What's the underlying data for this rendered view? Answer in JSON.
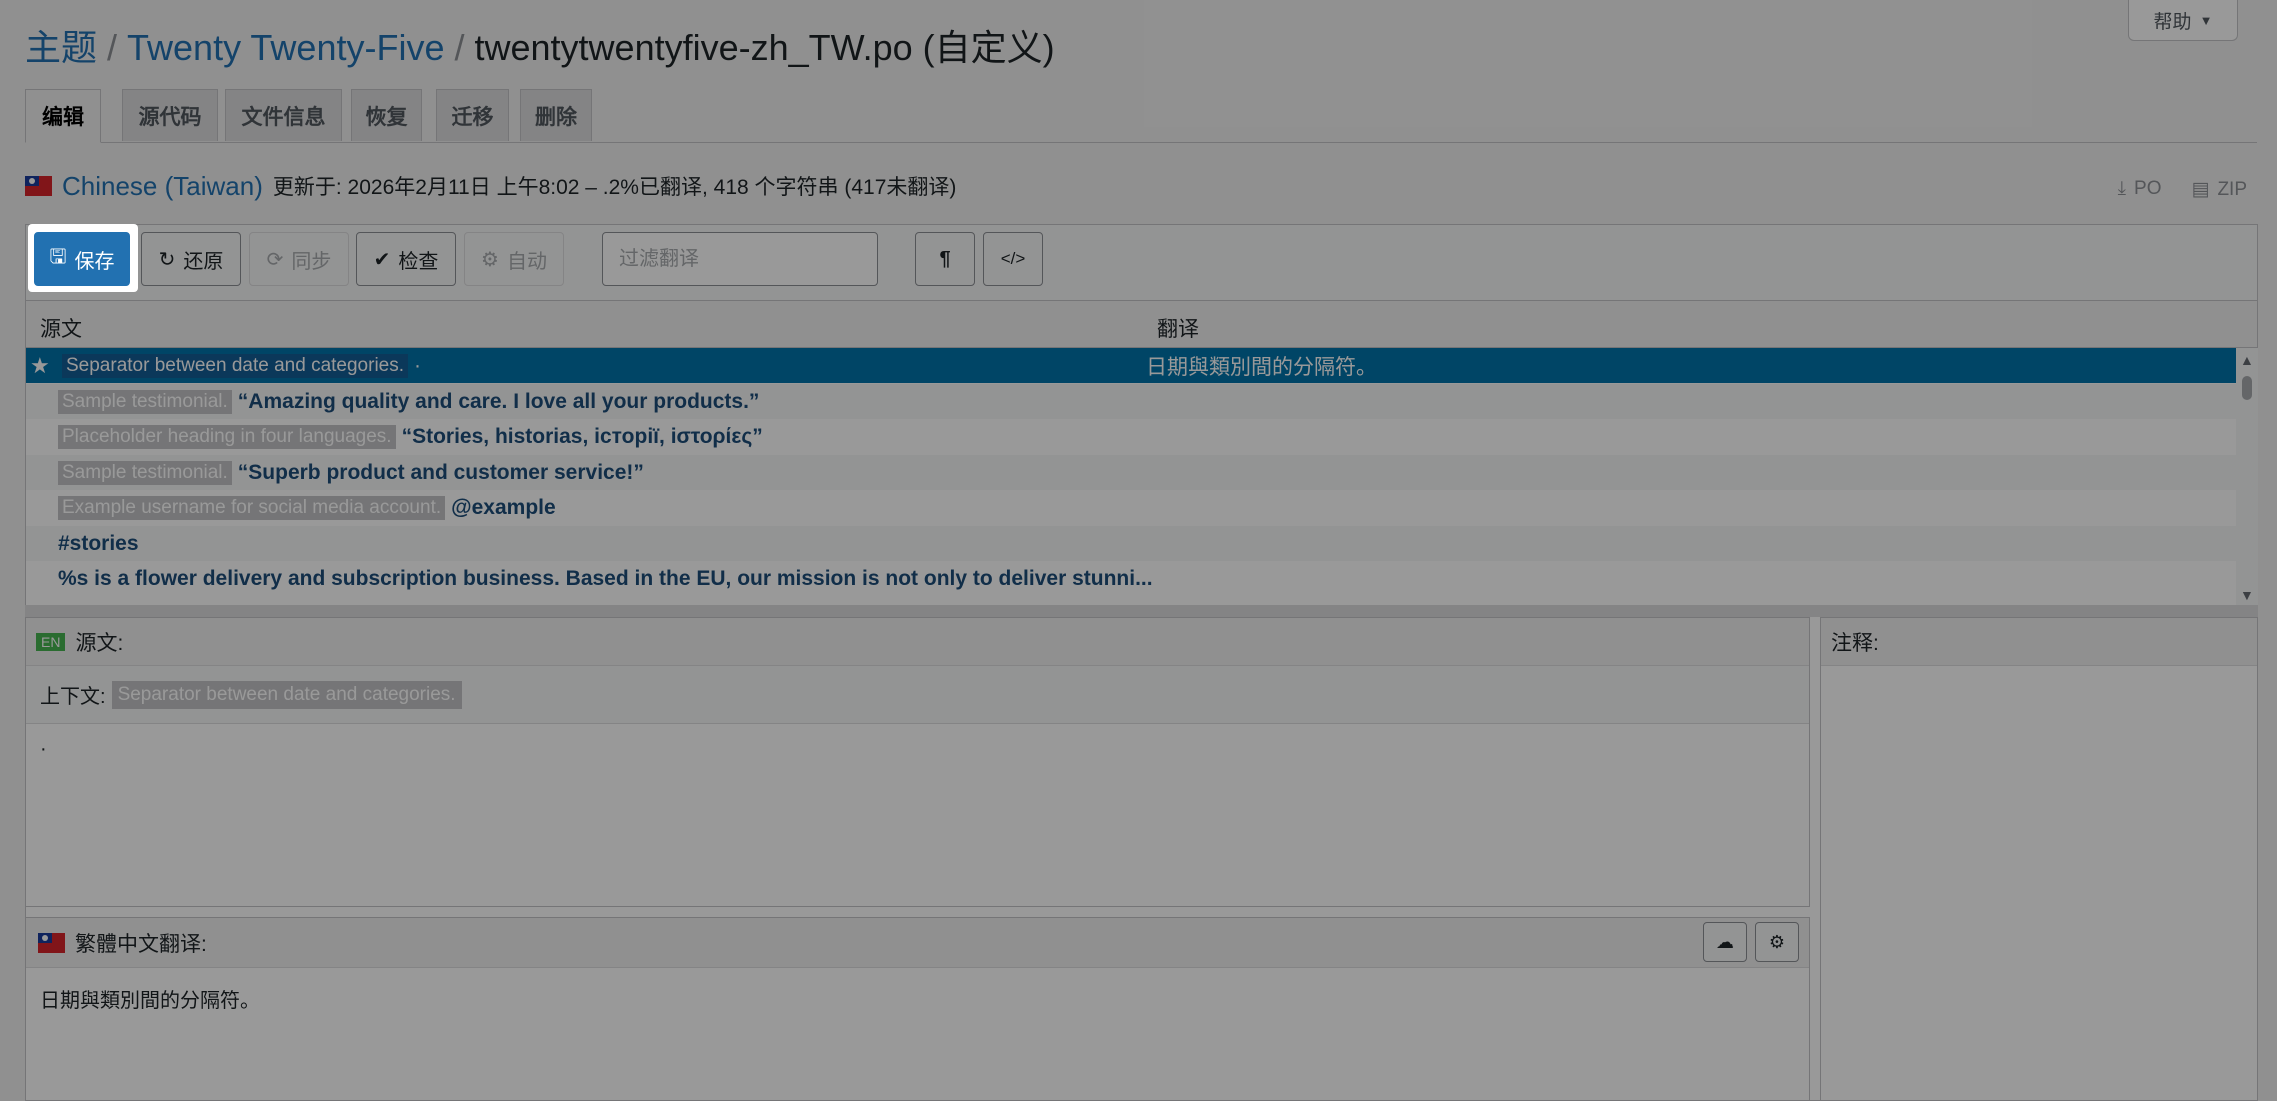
{
  "help_tab": {
    "label": "帮助"
  },
  "breadcrumb": {
    "themes": "主题",
    "theme": "Twenty Twenty-Five",
    "file": "twentytwentyfive-zh_TW.po (自定义)"
  },
  "tabs": [
    "编辑",
    "源代码",
    "文件信息",
    "恢复",
    "迁移",
    "删除"
  ],
  "locale": {
    "name": "Chinese (Taiwan)",
    "meta": "更新于: 2026年2月11日 上午8:02 – .2%已翻译, 418 个字符串 (417未翻译)"
  },
  "downloads": {
    "po": "PO",
    "zip": "ZIP"
  },
  "toolbar": {
    "save": "保存",
    "revert": "还原",
    "sync": "同步",
    "check": "检查",
    "auto": "自动",
    "filter_placeholder": "过滤翻译",
    "invisibles": "¶",
    "code": "</>"
  },
  "grid": {
    "source_header": "源文",
    "translation_header": "翻译",
    "rows": [
      {
        "context": "Separator between date and categories.",
        "source": "·",
        "translation": "日期與類別間的分隔符。",
        "selected": true,
        "starred": true
      },
      {
        "context": "Sample testimonial.",
        "source": "“Amazing quality and care. I love all your products.”",
        "translation": ""
      },
      {
        "context": "Placeholder heading in four languages.",
        "source": "“Stories, historias, iсторії, iστορίες”",
        "translation": ""
      },
      {
        "context": "Sample testimonial.",
        "source": "“Superb product and customer service!”",
        "translation": ""
      },
      {
        "context": "Example username for social media account.",
        "source": "@example",
        "translation": ""
      },
      {
        "context": "",
        "source": "#stories",
        "translation": ""
      },
      {
        "context": "",
        "source": "%s is a flower delivery and subscription business. Based in the EU, our mission is not only to deliver stunni...",
        "translation": ""
      }
    ]
  },
  "source_pane": {
    "lang": "EN",
    "title": "源文:",
    "context_label": "上下文:",
    "context_value": "Separator between date and categories.",
    "text": "·"
  },
  "notes_pane": {
    "title": "注释:"
  },
  "target_pane": {
    "title": "繁體中文翻译:",
    "text": "日期與類別間的分隔符。"
  }
}
